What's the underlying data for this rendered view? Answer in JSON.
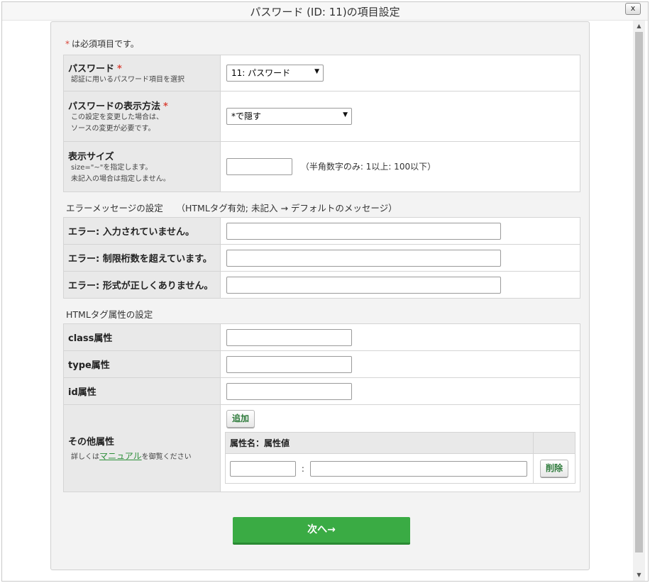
{
  "window": {
    "title": "パスワード (ID: 11)の項目設定",
    "close_label": "x"
  },
  "required_note": {
    "star": "*",
    "text": "は必須項目です。"
  },
  "fields": {
    "password": {
      "label": "パスワード",
      "star": "*",
      "desc": "認証に用いるパスワード項目を選択",
      "selected": "11: パスワード"
    },
    "display_method": {
      "label": "パスワードの表示方法",
      "star": "*",
      "desc1": "この設定を変更した場合は、",
      "desc2": "ソースの変更が必要です。",
      "selected": "*で隠す"
    },
    "display_size": {
      "label": "表示サイズ",
      "desc1": "size=\"~\"を指定します。",
      "desc2": "未記入の場合は指定しません。",
      "value": "",
      "hint": "（半角数字のみ: 1以上: 100以下）"
    }
  },
  "error_section": {
    "title": "エラーメッセージの設定　　（HTMLタグ有効; 未記入 → デフォルトのメッセージ）",
    "rows": [
      {
        "label": "エラー: 入力されていません。",
        "value": ""
      },
      {
        "label": "エラー: 制限桁数を超えています。",
        "value": ""
      },
      {
        "label": "エラー: 形式が正しくありません。",
        "value": ""
      }
    ]
  },
  "attr_section": {
    "title": "HTMLタグ属性の設定",
    "class_label": "class属性",
    "type_label": "type属性",
    "id_label": "id属性",
    "other_label": "その他属性",
    "other_desc_prefix": "詳しくは",
    "other_desc_link": "マニュアル",
    "other_desc_suffix": "を御覧ください",
    "add_label": "追加",
    "table_header": "属性名：属性値",
    "separator": ":",
    "delete_label": "削除"
  },
  "next_label": "次へ→",
  "icons": {
    "close": "close-icon",
    "caret": "caret-down-icon",
    "scroll_up": "arrow-up-icon",
    "scroll_down": "arrow-down-icon"
  }
}
